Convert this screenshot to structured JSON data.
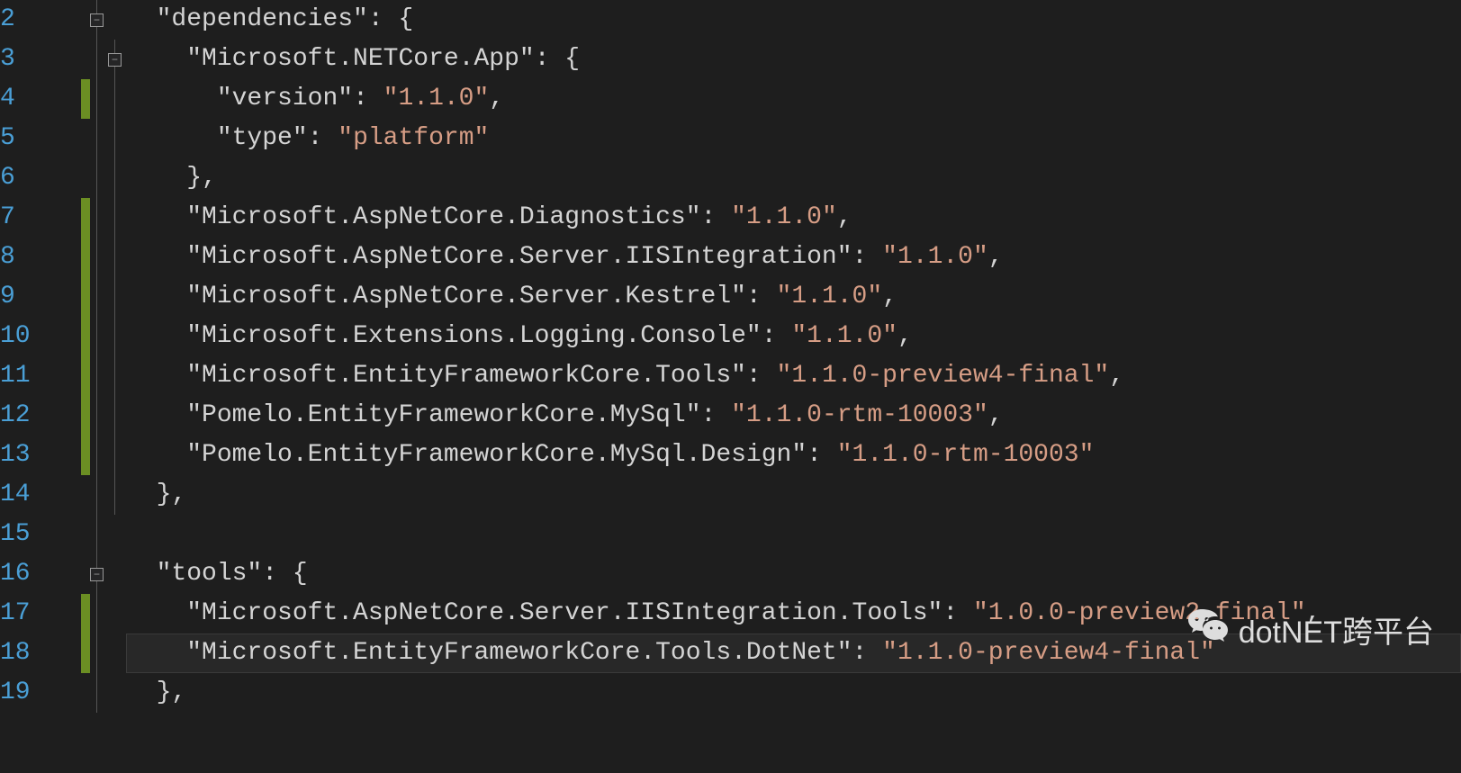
{
  "watermark_text": "dotNET跨平台",
  "lines": [
    {
      "num": "2",
      "changed": false,
      "fold": "minus",
      "indent": 1,
      "tokens": [
        {
          "t": "key",
          "v": "\"dependencies\""
        },
        {
          "t": "punct",
          "v": ": {"
        }
      ]
    },
    {
      "num": "3",
      "changed": false,
      "fold": "minus",
      "indent": 2,
      "tokens": [
        {
          "t": "key",
          "v": "\"Microsoft.NETCore.App\""
        },
        {
          "t": "punct",
          "v": ": {"
        }
      ]
    },
    {
      "num": "4",
      "changed": true,
      "indent": 3,
      "tokens": [
        {
          "t": "key",
          "v": "\"version\""
        },
        {
          "t": "punct",
          "v": ": "
        },
        {
          "t": "string",
          "v": "\"1.1.0\""
        },
        {
          "t": "punct",
          "v": ","
        }
      ]
    },
    {
      "num": "5",
      "changed": false,
      "indent": 3,
      "tokens": [
        {
          "t": "key",
          "v": "\"type\""
        },
        {
          "t": "punct",
          "v": ": "
        },
        {
          "t": "string",
          "v": "\"platform\""
        }
      ]
    },
    {
      "num": "6",
      "changed": false,
      "indent": 2,
      "tokens": [
        {
          "t": "punct",
          "v": "},"
        }
      ]
    },
    {
      "num": "7",
      "changed": true,
      "indent": 2,
      "tokens": [
        {
          "t": "key",
          "v": "\"Microsoft.AspNetCore.Diagnostics\""
        },
        {
          "t": "punct",
          "v": ": "
        },
        {
          "t": "string",
          "v": "\"1.1.0\""
        },
        {
          "t": "punct",
          "v": ","
        }
      ]
    },
    {
      "num": "8",
      "changed": true,
      "indent": 2,
      "tokens": [
        {
          "t": "key",
          "v": "\"Microsoft.AspNetCore.Server.IISIntegration\""
        },
        {
          "t": "punct",
          "v": ": "
        },
        {
          "t": "string",
          "v": "\"1.1.0\""
        },
        {
          "t": "punct",
          "v": ","
        }
      ]
    },
    {
      "num": "9",
      "changed": true,
      "indent": 2,
      "tokens": [
        {
          "t": "key",
          "v": "\"Microsoft.AspNetCore.Server.Kestrel\""
        },
        {
          "t": "punct",
          "v": ": "
        },
        {
          "t": "string",
          "v": "\"1.1.0\""
        },
        {
          "t": "punct",
          "v": ","
        }
      ]
    },
    {
      "num": "10",
      "changed": true,
      "indent": 2,
      "tokens": [
        {
          "t": "key",
          "v": "\"Microsoft.Extensions.Logging.Console\""
        },
        {
          "t": "punct",
          "v": ": "
        },
        {
          "t": "string",
          "v": "\"1.1.0\""
        },
        {
          "t": "punct",
          "v": ","
        }
      ]
    },
    {
      "num": "11",
      "changed": true,
      "indent": 2,
      "tokens": [
        {
          "t": "key",
          "v": "\"Microsoft.EntityFrameworkCore.Tools\""
        },
        {
          "t": "punct",
          "v": ": "
        },
        {
          "t": "string",
          "v": "\"1.1.0-preview4-final\""
        },
        {
          "t": "punct",
          "v": ","
        }
      ]
    },
    {
      "num": "12",
      "changed": true,
      "indent": 2,
      "tokens": [
        {
          "t": "key",
          "v": "\"Pomelo.EntityFrameworkCore.MySql\""
        },
        {
          "t": "punct",
          "v": ": "
        },
        {
          "t": "string",
          "v": "\"1.1.0-rtm-10003\""
        },
        {
          "t": "punct",
          "v": ","
        }
      ]
    },
    {
      "num": "13",
      "changed": true,
      "indent": 2,
      "tokens": [
        {
          "t": "key",
          "v": "\"Pomelo.EntityFrameworkCore.MySql.Design\""
        },
        {
          "t": "punct",
          "v": ": "
        },
        {
          "t": "string",
          "v": "\"1.1.0-rtm-10003\""
        }
      ]
    },
    {
      "num": "14",
      "changed": false,
      "indent": 1,
      "tokens": [
        {
          "t": "punct",
          "v": "},"
        }
      ]
    },
    {
      "num": "15",
      "changed": false,
      "indent": 0,
      "tokens": []
    },
    {
      "num": "16",
      "changed": false,
      "fold": "minus",
      "indent": 1,
      "tokens": [
        {
          "t": "key",
          "v": "\"tools\""
        },
        {
          "t": "punct",
          "v": ": {"
        }
      ]
    },
    {
      "num": "17",
      "changed": true,
      "indent": 2,
      "tokens": [
        {
          "t": "key",
          "v": "\"Microsoft.AspNetCore.Server.IISIntegration.Tools\""
        },
        {
          "t": "punct",
          "v": ": "
        },
        {
          "t": "string",
          "v": "\"1.0.0-preview2-final\""
        },
        {
          "t": "punct",
          "v": ","
        }
      ]
    },
    {
      "num": "18",
      "changed": true,
      "highlight": true,
      "indent": 2,
      "tokens": [
        {
          "t": "key",
          "v": "\"Microsoft.EntityFrameworkCore.Tools.DotNet\""
        },
        {
          "t": "punct",
          "v": ": "
        },
        {
          "t": "string",
          "v": "\"1.1.0-preview4-final\""
        }
      ]
    },
    {
      "num": "19",
      "changed": false,
      "indent": 1,
      "tokens": [
        {
          "t": "punct",
          "v": "},"
        }
      ]
    }
  ]
}
